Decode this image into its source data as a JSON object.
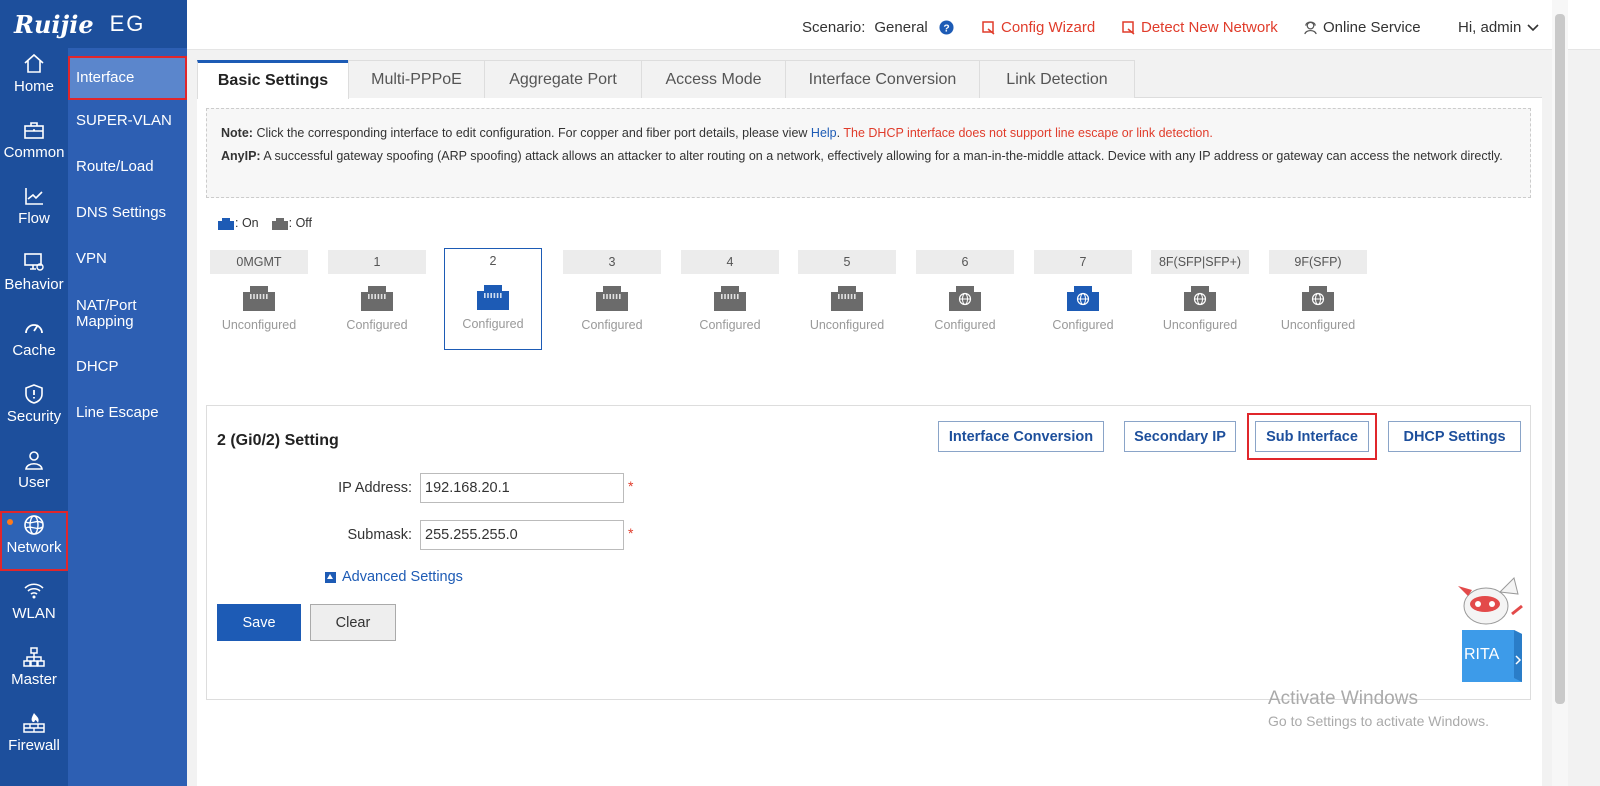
{
  "brand": {
    "logo": "Ruijie",
    "model": "EG"
  },
  "rail": [
    {
      "label": "Home",
      "icon": "home-icon"
    },
    {
      "label": "Common",
      "icon": "toolbox-icon"
    },
    {
      "label": "Flow",
      "icon": "chart-icon"
    },
    {
      "label": "Behavior",
      "icon": "monitor-icon"
    },
    {
      "label": "Cache",
      "icon": "gauge-icon"
    },
    {
      "label": "Security",
      "icon": "shield-icon"
    },
    {
      "label": "User",
      "icon": "user-icon"
    },
    {
      "label": "Network",
      "icon": "globe-icon",
      "active": true
    },
    {
      "label": "WLAN",
      "icon": "wifi-icon"
    },
    {
      "label": "Master",
      "icon": "topology-icon"
    },
    {
      "label": "Firewall",
      "icon": "firewall-icon"
    }
  ],
  "submenu": [
    "Interface",
    "SUPER-VLAN",
    "Route/Load",
    "DNS Settings",
    "VPN",
    "NAT/Port Mapping",
    "DHCP",
    "Line Escape"
  ],
  "header": {
    "scenario_label": "Scenario:",
    "scenario_value": "General",
    "config_wizard": "Config Wizard",
    "detect_network": "Detect New Network",
    "online_service": "Online Service",
    "greeting": "Hi, admin"
  },
  "tabs": [
    "Basic Settings",
    "Multi-PPPoE",
    "Aggregate Port",
    "Access Mode",
    "Interface Conversion",
    "Link Detection"
  ],
  "note": {
    "note_label": "Note:",
    "note_text": "Click the corresponding interface to edit configuration. For copper and fiber port details, please view",
    "help_link": "Help",
    "help_sep": ".",
    "warn_text": "The DHCP interface does not support line escape or link detection.",
    "anyip_label": "AnyIP:",
    "anyip_text": "A successful gateway spoofing (ARP spoofing) attack allows an attacker to alter routing on a network, effectively allowing for a man-in-the-middle attack. Device with any IP address or gateway can access the network directly."
  },
  "legend": {
    "on": ": On",
    "off": ": Off"
  },
  "colors": {
    "on": "#1d5bb5",
    "off": "#6b6b6b",
    "accent": "#1d5bb5",
    "alert": "#e03c2b"
  },
  "ports": [
    {
      "name": "0MGMT",
      "status": "Unconfigured",
      "on": false,
      "wan": false
    },
    {
      "name": "1",
      "status": "Configured",
      "on": false,
      "wan": false
    },
    {
      "name": "2",
      "status": "Configured",
      "on": true,
      "wan": false,
      "selected": true
    },
    {
      "name": "3",
      "status": "Configured",
      "on": false,
      "wan": false
    },
    {
      "name": "4",
      "status": "Configured",
      "on": false,
      "wan": false
    },
    {
      "name": "5",
      "status": "Unconfigured",
      "on": false,
      "wan": false
    },
    {
      "name": "6",
      "status": "Configured",
      "on": false,
      "wan": true
    },
    {
      "name": "7",
      "status": "Configured",
      "on": true,
      "wan": true
    },
    {
      "name": "8F(SFP|SFP+)",
      "status": "Unconfigured",
      "on": false,
      "wan": true
    },
    {
      "name": "9F(SFP)",
      "status": "Unconfigured",
      "on": false,
      "wan": true
    }
  ],
  "setting": {
    "title": "2 (Gi0/2) Setting",
    "btn_conversion": "Interface Conversion",
    "btn_secondary": "Secondary IP",
    "btn_sub": "Sub Interface",
    "btn_dhcp": "DHCP Settings",
    "ip_label": "IP Address:",
    "ip_value": "192.168.20.1",
    "mask_label": "Submask:",
    "mask_value": "255.255.255.0",
    "required": "*",
    "advanced": "Advanced Settings",
    "save": "Save",
    "clear": "Clear"
  },
  "assistant": {
    "label": "RITA"
  },
  "watermark": {
    "line1": "Activate Windows",
    "line2": "Go to Settings to activate Windows."
  }
}
